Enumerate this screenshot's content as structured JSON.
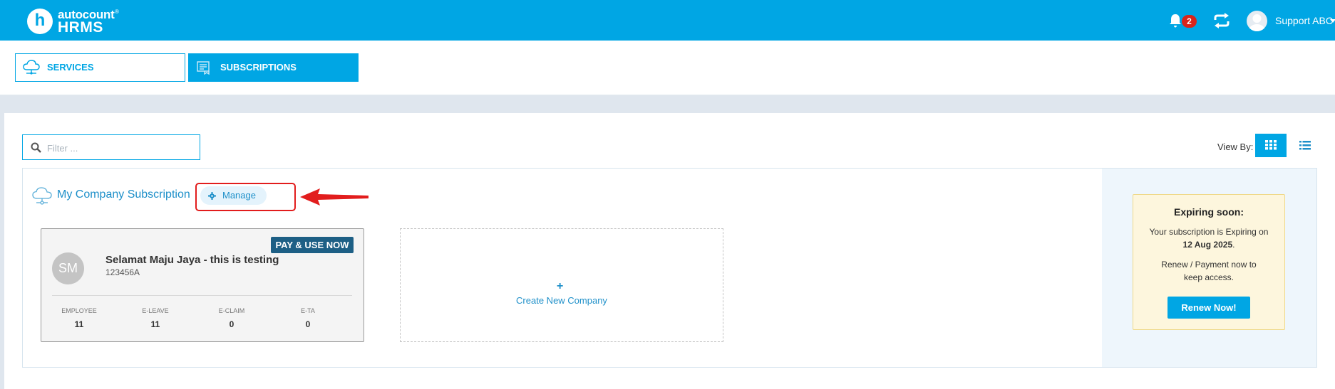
{
  "brand": {
    "logo_letter": "h",
    "logo_top": "autocount",
    "logo_reg": "®",
    "logo_bottom": "HRMS",
    "primary_color": "#00a6e4"
  },
  "header": {
    "notification_icon": "bell-icon",
    "notification_count": "2",
    "sync_icon": "sync-icon",
    "user_name": "Support ABC",
    "user_menu_icon": "caret-down-icon"
  },
  "tabs": [
    {
      "label": "SERVICES",
      "icon": "cloud-icon",
      "active": false
    },
    {
      "label": "SUBSCRIPTIONS",
      "icon": "subscription-icon",
      "active": true
    }
  ],
  "filter": {
    "placeholder": "Filter ...",
    "value": ""
  },
  "view_by": {
    "label": "View By:",
    "options": [
      "grid",
      "list"
    ],
    "selected": "grid"
  },
  "subscription": {
    "title": "My Company Subscription",
    "manage_label": "Manage",
    "annotation_color": "#e21d1d"
  },
  "company": {
    "initials": "SM",
    "name": "Selamat Maju Jaya - this is testing",
    "code": "123456A",
    "status_badge": "PAY & USE NOW",
    "stats": [
      {
        "label": "EMPLOYEE",
        "value": "11"
      },
      {
        "label": "E-LEAVE",
        "value": "11"
      },
      {
        "label": "E-CLAIM",
        "value": "0"
      },
      {
        "label": "E-TA",
        "value": "0"
      }
    ]
  },
  "create_company": {
    "plus": "+",
    "label": "Create New Company"
  },
  "expiring": {
    "title": "Expiring soon:",
    "line1": "Your subscription is Expiring on",
    "date": "12 Aug 2025",
    "date_suffix": ".",
    "line2a": "Renew / Payment now to",
    "line2b": "keep access.",
    "renew_label": "Renew Now!"
  }
}
